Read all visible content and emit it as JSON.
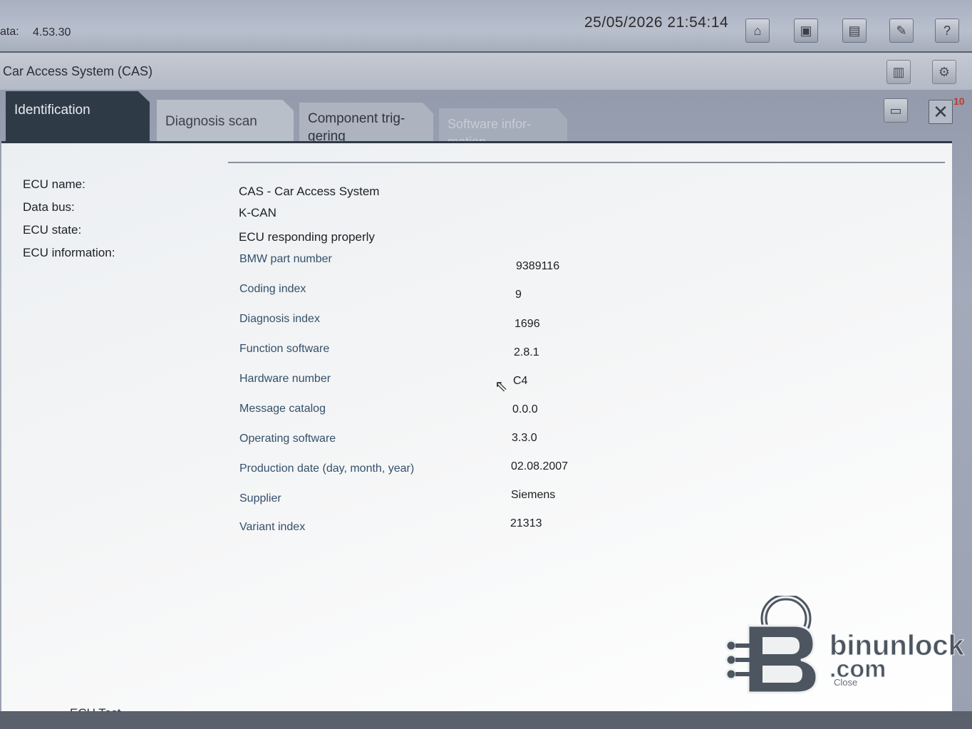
{
  "header": {
    "version_label": "ata:",
    "version_value": "4.53.30",
    "datetime": "25/05/2026 21:54:14",
    "toolbar": [
      {
        "name": "home-icon",
        "glyph": "⌂"
      },
      {
        "name": "vehicle-icon",
        "glyph": "▣"
      },
      {
        "name": "monitor-icon",
        "glyph": "▤"
      },
      {
        "name": "wrench-icon",
        "glyph": "✎"
      },
      {
        "name": "help-icon",
        "glyph": "?"
      }
    ]
  },
  "window": {
    "title": "Car Access System (CAS)",
    "badge": "10",
    "settings_glyph": "⚙",
    "doc_glyph": "▥",
    "print_glyph": "▭",
    "close_glyph": "✕"
  },
  "tabs": [
    {
      "label": "Identification",
      "active": true
    },
    {
      "label": "Diagnosis scan",
      "active": false
    },
    {
      "label": "Component trig-\ngering",
      "active": false
    },
    {
      "label": "Software infor-\nmation",
      "active": false
    }
  ],
  "ecu": {
    "name_label": "ECU name:",
    "name_value": "CAS - Car Access System",
    "bus_label": "Data bus:",
    "bus_value": "K-CAN",
    "state_label": "ECU state:",
    "state_value": "ECU responding properly",
    "info_label": "ECU information:",
    "info": [
      {
        "key": "BMW part number",
        "value": "9389116"
      },
      {
        "key": "Coding index",
        "value": "9"
      },
      {
        "key": "Diagnosis index",
        "value": "1696"
      },
      {
        "key": "Function software",
        "value": "2.8.1"
      },
      {
        "key": "Hardware number",
        "value": "C4"
      },
      {
        "key": "Message catalog",
        "value": "0.0.0"
      },
      {
        "key": "Operating software",
        "value": "3.3.0"
      },
      {
        "key": "Production date (day, month, year)",
        "value": "02.08.2007"
      },
      {
        "key": "Supplier",
        "value": "Siemens"
      },
      {
        "key": "Variant index",
        "value": "21313"
      }
    ]
  },
  "footer": {
    "ecu_test": "ECU Test",
    "close_label": "Close"
  },
  "watermark": {
    "name": "binunlock",
    "tld": ".com"
  }
}
